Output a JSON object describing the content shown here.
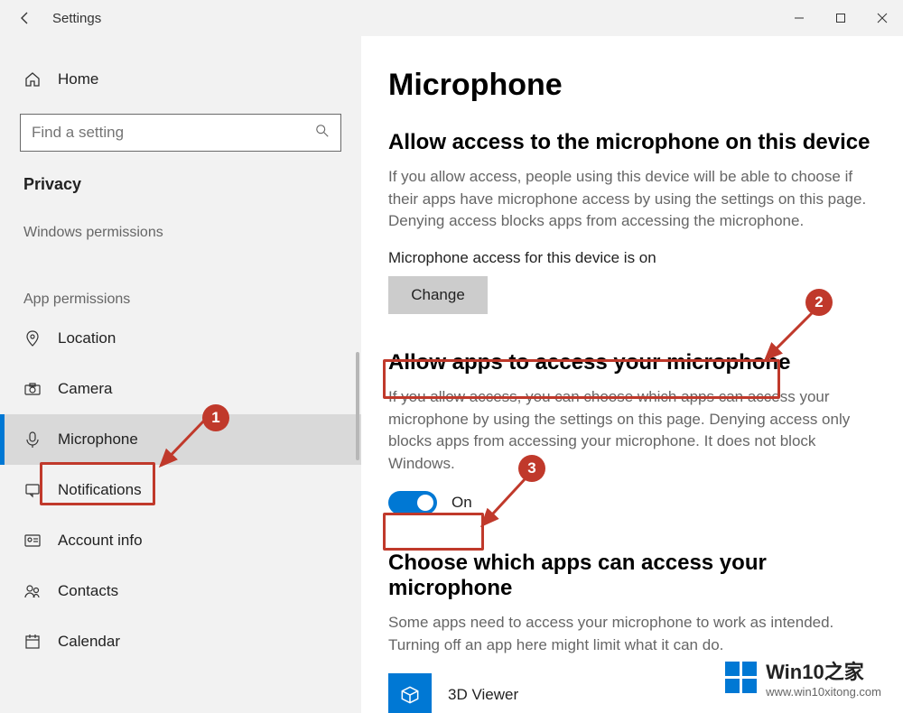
{
  "titlebar": {
    "title": "Settings"
  },
  "sidebar": {
    "home_label": "Home",
    "search_placeholder": "Find a setting",
    "category_label": "Privacy",
    "group1_label": "Windows permissions",
    "group2_label": "App permissions",
    "items": [
      {
        "label": "Location"
      },
      {
        "label": "Camera"
      },
      {
        "label": "Microphone"
      },
      {
        "label": "Notifications"
      },
      {
        "label": "Account info"
      },
      {
        "label": "Contacts"
      },
      {
        "label": "Calendar"
      }
    ]
  },
  "content": {
    "page_title": "Microphone",
    "section1_title": "Allow access to the microphone on this device",
    "section1_desc": "If you allow access, people using this device will be able to choose if their apps have microphone access by using the settings on this page. Denying access blocks apps from accessing the microphone.",
    "status_line": "Microphone access for this device is on",
    "change_label": "Change",
    "section2_title": "Allow apps to access your microphone",
    "section2_desc": "If you allow access, you can choose which apps can access your microphone by using the settings on this page. Denying access only blocks apps from accessing your microphone. It does not block Windows.",
    "toggle_label": "On",
    "section3_title": "Choose which apps can access your microphone",
    "section3_desc": "Some apps need to access your microphone to work as intended. Turning off an app here might limit what it can do.",
    "app1_name": "3D Viewer"
  },
  "annotations": {
    "badge1": "1",
    "badge2": "2",
    "badge3": "3"
  },
  "watermark": {
    "line1": "Win10之家",
    "line2": "www.win10xitong.com"
  }
}
